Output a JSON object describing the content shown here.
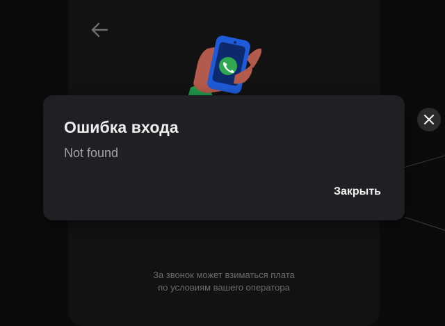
{
  "dialog": {
    "title": "Ошибка входа",
    "message": "Not found",
    "close_label": "Закрыть"
  },
  "footnote": {
    "line1": "За звонок может взиматься плата",
    "line2": "по условиям вашего оператора"
  },
  "icons": {
    "back": "arrow-left-icon",
    "close": "close-icon",
    "illustration": "phone-call-hand-icon"
  },
  "colors": {
    "background": "#0b0b0b",
    "panel": "#121212",
    "dialog": "#1f2023",
    "phone": "#1e5bd8",
    "call_icon": "#2fa84f",
    "hand": "#b25a4b"
  }
}
